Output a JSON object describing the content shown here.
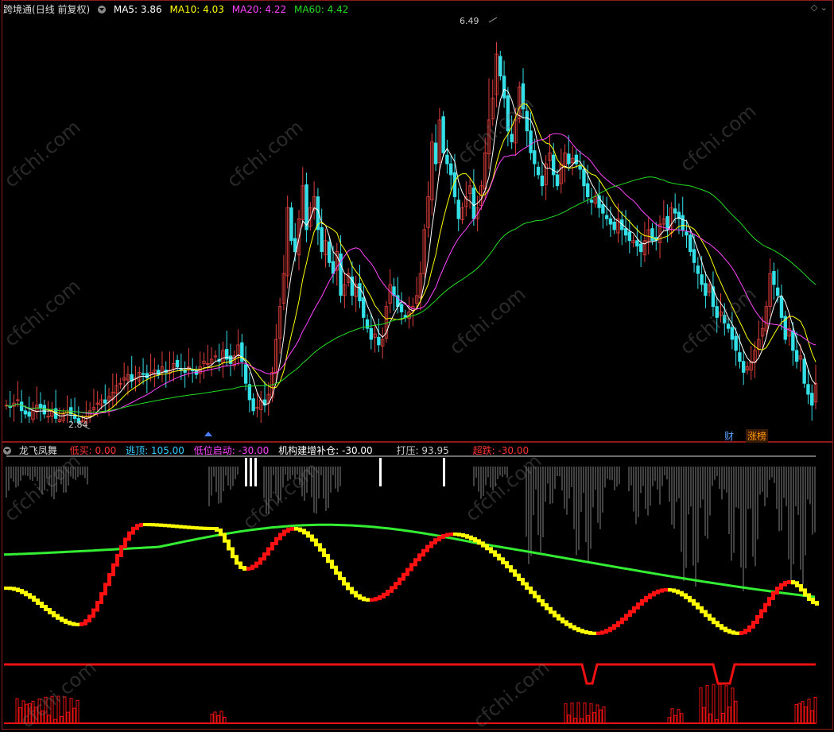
{
  "main": {
    "title": "跨境通",
    "title_suffix": "(日线 前复权)",
    "ma": [
      {
        "label": "MA5: 3.86",
        "color": "#ffffff"
      },
      {
        "label": "MA10: 4.03",
        "color": "#ffff00"
      },
      {
        "label": "MA20: 4.22",
        "color": "#ff44ff"
      },
      {
        "label": "MA60: 4.42",
        "color": "#22dd22"
      }
    ],
    "high_label": "6.49",
    "low_label": "2.84",
    "tag_cai": "财",
    "tag_zhangbang": "涨榜"
  },
  "indicator": {
    "name": "龙飞凤舞",
    "items": [
      {
        "label": "低买: 0.00",
        "color": "#ff3333"
      },
      {
        "label": "逃顶: 105.00",
        "color": "#33ccff"
      },
      {
        "label": "低位启动: -30.00",
        "color": "#ff44ff"
      },
      {
        "label": "机构建增补仓: -30.00",
        "color": "#ffffff"
      },
      {
        "label": "打压: 93.95",
        "color": "#cccccc"
      },
      {
        "label": "超跌: -30.00",
        "color": "#ff3333"
      }
    ]
  },
  "watermark": "cfchi.com",
  "colors": {
    "up": "#e0403c",
    "down": "#33e0e8",
    "ma5": "#ffffff",
    "ma10": "#ffff00",
    "ma20": "#ff44ff",
    "ma60": "#22dd22",
    "frame": "#8b1a1a"
  },
  "chart_data": {
    "type": "line",
    "candles_close": [
      3.0,
      2.98,
      3.02,
      3.05,
      2.95,
      2.92,
      2.9,
      2.95,
      3.0,
      2.97,
      2.92,
      2.9,
      2.95,
      2.88,
      2.87,
      2.92,
      2.95,
      2.92,
      2.88,
      2.84,
      2.86,
      2.9,
      2.95,
      2.98,
      3.02,
      3.05,
      3.02,
      3.08,
      3.12,
      3.18,
      3.2,
      3.25,
      3.28,
      3.22,
      3.25,
      3.3,
      3.28,
      3.25,
      3.3,
      3.32,
      3.28,
      3.35,
      3.3,
      3.32,
      3.38,
      3.35,
      3.32,
      3.3,
      3.35,
      3.32,
      3.28,
      3.35,
      3.4,
      3.38,
      3.42,
      3.45,
      3.4,
      3.5,
      3.42,
      3.38,
      3.45,
      3.55,
      3.4,
      3.2,
      3.05,
      2.95,
      2.98,
      3.05,
      3.0,
      3.1,
      3.3,
      3.6,
      3.9,
      4.2,
      4.8,
      4.5,
      4.4,
      4.7,
      5.0,
      4.6,
      4.8,
      4.9,
      4.6,
      4.4,
      4.5,
      4.3,
      4.2,
      4.4,
      4.0,
      4.1,
      4.2,
      4.0,
      4.1,
      3.95,
      3.8,
      3.7,
      3.6,
      3.65,
      3.55,
      3.6,
      3.9,
      4.1,
      4.0,
      3.9,
      3.85,
      3.8,
      3.85,
      3.9,
      4.0,
      4.2,
      4.6,
      4.9,
      5.4,
      5.2,
      5.6,
      5.3,
      5.2,
      5.1,
      4.9,
      4.7,
      4.8,
      4.9,
      5.0,
      4.7,
      4.8,
      5.0,
      5.3,
      5.6,
      5.8,
      6.2,
      6.0,
      5.8,
      5.5,
      5.4,
      5.6,
      5.9,
      5.7,
      5.5,
      5.3,
      5.2,
      5.1,
      5.0,
      5.2,
      5.3,
      5.1,
      5.0,
      5.2,
      5.3,
      5.2,
      5.25,
      5.2,
      5.15,
      5.0,
      4.9,
      4.85,
      4.9,
      4.8,
      4.75,
      4.7,
      4.65,
      4.6,
      4.7,
      4.6,
      4.55,
      4.5,
      4.5,
      4.45,
      4.4,
      4.5,
      4.6,
      4.5,
      4.5,
      4.65,
      4.7,
      4.6,
      4.8,
      4.75,
      4.7,
      4.6,
      4.55,
      4.4,
      4.3,
      4.2,
      4.1,
      4.0,
      4.1,
      3.9,
      3.8,
      3.85,
      3.75,
      3.7,
      3.6,
      3.5,
      3.4,
      3.3,
      3.35,
      3.4,
      3.5,
      3.6,
      3.7,
      3.9,
      4.2,
      4.1,
      4.0,
      3.8,
      3.6,
      3.7,
      3.5,
      3.4,
      3.45,
      3.2,
      3.1,
      3.0,
      3.2
    ],
    "price_max": 6.49,
    "price_min": 2.84,
    "indicator_values": {
      "低买": 0.0,
      "逃顶": 105.0,
      "低位启动": -30.0,
      "机构建增补仓": -30.0,
      "打压": 93.95,
      "超跌": -30.0
    }
  }
}
